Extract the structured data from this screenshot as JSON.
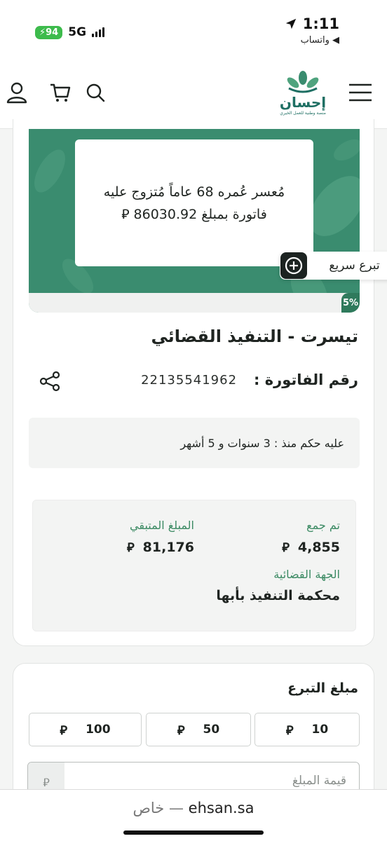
{
  "status_bar": {
    "time": "1:11",
    "battery": "94",
    "network": "5G",
    "back_app": "◀ واتساب"
  },
  "header": {
    "logo_text": "إحسان",
    "logo_subtitle": "منصة وطنية للعمل الخيري",
    "icons": [
      "menu-icon",
      "search-icon",
      "cart-icon",
      "user-icon"
    ]
  },
  "case": {
    "hero_line1": "مُعسر عُمره 68 عاماً مُتزوج عليه",
    "hero_line2": "فاتورة بمبلغ 86030.92 ⃁",
    "quick_donate": "تبرع سريع",
    "progress_label": "5%",
    "progress": 0.05,
    "title": "تيسرت - التنفيذ القضائي",
    "invoice_label": "رقم الفاتورة :",
    "invoice_number": "22135541962",
    "judgment": "عليه حكم منذ : 3 سنوات و 5 أشهر",
    "collected_label": "تم جمع",
    "collected_value": "4,855",
    "remaining_label": "المبلغ المتبقي",
    "remaining_value": "81,176",
    "court_label": "الجهة القضائية",
    "court_value": "محكمة التنفيذ بأبها",
    "currency": "⃁"
  },
  "donation": {
    "title": "مبلغ التبرع",
    "amounts": [
      "10",
      "50",
      "100"
    ],
    "input_placeholder": "قيمة المبلغ"
  },
  "browser": {
    "private_label": "خاص —",
    "domain": "ehsan.sa"
  },
  "colors": {
    "brand_green": "#3a8c6f",
    "label_green": "#3b8a63"
  }
}
